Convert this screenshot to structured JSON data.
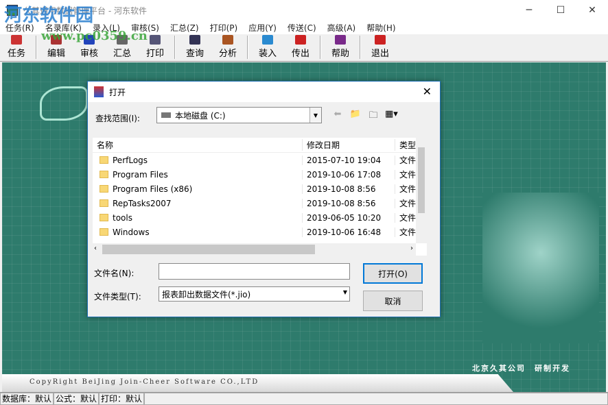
{
  "window": {
    "title": "久其通用数据管理平台 - 河东软件",
    "minimize": "─",
    "maximize": "☐",
    "close": "✕"
  },
  "watermark": {
    "name": "河东软件园",
    "url": "www.pc0359.cn"
  },
  "menu": [
    "任务(R)",
    "名录库(K)",
    "录入(L)",
    "审核(S)",
    "汇总(Z)",
    "打印(P)",
    "应用(Y)",
    "传送(C)",
    "高级(A)",
    "帮助(H)"
  ],
  "toolbar": [
    {
      "label": "任务",
      "color": "#c33"
    },
    {
      "label": "编辑",
      "color": "#a33"
    },
    {
      "label": "审核",
      "color": "#2244bb"
    },
    {
      "label": "汇总",
      "color": "#666"
    },
    {
      "label": "打印",
      "color": "#557"
    },
    {
      "label": "查询",
      "color": "#335"
    },
    {
      "label": "分析",
      "color": "#a52"
    },
    {
      "label": "装入",
      "color": "#2a8ad0"
    },
    {
      "label": "传出",
      "color": "#c22"
    },
    {
      "label": "帮助",
      "color": "#7a2a8a"
    },
    {
      "label": "退出",
      "color": "#c22"
    }
  ],
  "background": {
    "company": "北京久其公司　研制开发",
    "copyright": "CopyRight BeiJing Join-Cheer Software CO.,LTD"
  },
  "status": [
    "数据库：默认",
    "公式：默认",
    "打印：默认"
  ],
  "dialog": {
    "title": "打开",
    "close": "✕",
    "lookin_label": "查找范围(I):",
    "lookin_value": "本地磁盘 (C:)",
    "columns": [
      "名称",
      "修改日期",
      "类型"
    ],
    "files": [
      {
        "name": "PerfLogs",
        "date": "2015-07-10 19:04",
        "type": "文件"
      },
      {
        "name": "Program Files",
        "date": "2019-10-06 17:08",
        "type": "文件"
      },
      {
        "name": "Program Files (x86)",
        "date": "2019-10-08 8:56",
        "type": "文件"
      },
      {
        "name": "RepTasks2007",
        "date": "2019-10-08 8:56",
        "type": "文件"
      },
      {
        "name": "tools",
        "date": "2019-06-05 10:20",
        "type": "文件"
      },
      {
        "name": "Windows",
        "date": "2019-10-06 16:48",
        "type": "文件"
      }
    ],
    "filename_label": "文件名(N):",
    "filename_value": "",
    "filetype_label": "文件类型(T):",
    "filetype_value": "报表卸出数据文件(*.jio)",
    "open_button": "打开(O)",
    "cancel_button": "取消"
  }
}
